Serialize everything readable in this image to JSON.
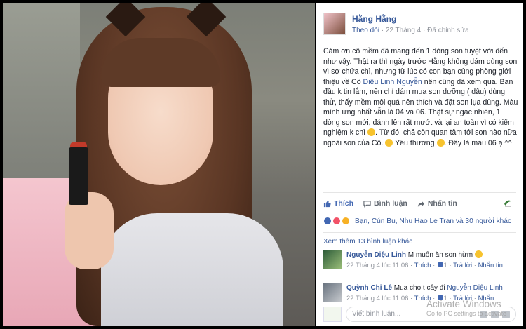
{
  "post": {
    "author": "Hằng Hằng",
    "follow": "Theo dõi",
    "date": "22 Tháng 4",
    "separator": "·",
    "edited": "Đã chỉnh sửa",
    "body": {
      "p1": "Cảm ơn cô mềm đã mang đến 1 dòng son tuyệt vời đến như vậy. Thật ra thì ngày trước Hằng không dám dùng son vì sợ chứa chì, nhưng từ lúc có con bạn cùng phòng giới thiệu về Cô ",
      "mention": "Diệu Linh Nguyễn",
      "p2": " nên cũng đã xem qua. Ban đầu k tin lắm, nên chỉ dám mua son dưỡng ( dâu) dùng thử, thấy mềm môi quá nên thích và đặt son lụa dùng. Màu mình ưng nhất vẫn là 04 và 06. Thật sự ngạc nhiên, 1 dòng son mới, đánh lên rất mướt và lại an toàn vì có kiểm nghiệm k chì ",
      "p3": ". Từ đó, chả còn quan tâm tới son nào nữa ngoài son của Cô. ",
      "p4": " Yêu thương ",
      "p5": ". Đây là màu 06 ạ ^^"
    }
  },
  "actions": {
    "like": "Thích",
    "comment": "Bình luận",
    "share": "Nhấn tin"
  },
  "reactions": {
    "text": "Bạn, Cún Bu, Nhu Hao Le Tran và 30 người khác",
    "colors": [
      "#4267b2",
      "#f25268",
      "#f7b125"
    ]
  },
  "more_comments": "Xem thêm 13 bình luận khác",
  "comments": [
    {
      "name": "Nguyễn Diệu Linh",
      "text": " M muốn ăn son hừm ",
      "date": "22 Tháng 4 lúc 11:06",
      "like": "Thích",
      "likes_count": "1",
      "reply": "Trả lời",
      "share": "Nhắn tin"
    },
    {
      "name": "Quỳnh Chi Lê",
      "text": " Mua cho t cây đi ",
      "mention": "Nguyễn Diệu Linh",
      "date": "22 Tháng 4 lúc 11:06",
      "like": "Thích",
      "likes_count": "1",
      "reply": "Trả lời",
      "share": "Nhắn"
    }
  ],
  "composer": {
    "placeholder": "Viết bình luận..."
  },
  "watermark": {
    "title": "Activate Windows",
    "subtitle": "Go to PC settings to activate"
  }
}
